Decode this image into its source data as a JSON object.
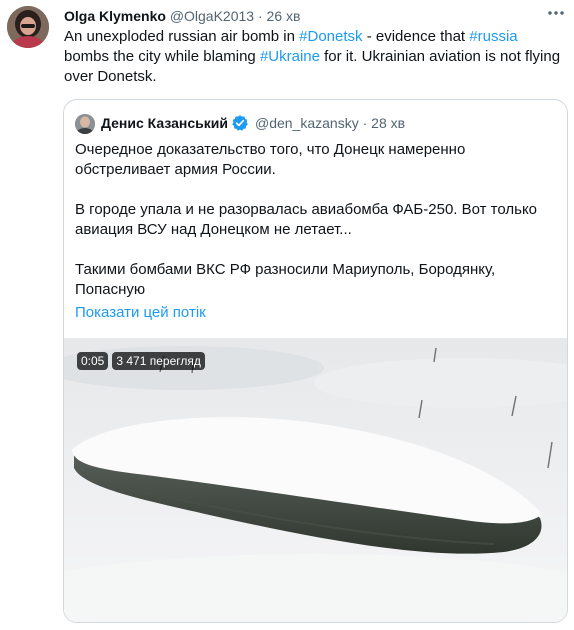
{
  "tweet": {
    "name": "Olga Klymenko",
    "handle": "@OlgaK2013",
    "separator": "·",
    "time": "26 хв",
    "more_icon": "more-horizontal-icon",
    "text_parts": {
      "p1": "An unexploded russian air bomb in ",
      "tag1": "#Donetsk",
      "p2": " - evidence that ",
      "tag2": "#russia",
      "p3": " bombs the city while blaming ",
      "tag3": "#Ukraine",
      "p4": " for it. Ukrainian aviation is not flying over Donetsk."
    }
  },
  "quote": {
    "name": "Денис Казанський",
    "verified_icon": "verified-badge-icon",
    "handle": "@den_kazansky",
    "separator": "·",
    "time": "28 хв",
    "paragraph1": "Очередное доказательство того, что Донецк намеренно обстреливает армия России.",
    "paragraph2": "В городе упала и не разорвалась авиабомба ФАБ-250. Вот только авиация ВСУ над Донецком не летает...",
    "paragraph3": "Такими бомбами ВКС РФ разносили Мариуполь, Бородянку, Попасную",
    "show_thread": "Показати цей потік",
    "video": {
      "duration": "0:05",
      "views": "3 471 перегляд"
    }
  },
  "colors": {
    "accent": "#1d9bf0",
    "text": "#0f1419",
    "secondary": "#536471",
    "border": "#cfd9de"
  }
}
